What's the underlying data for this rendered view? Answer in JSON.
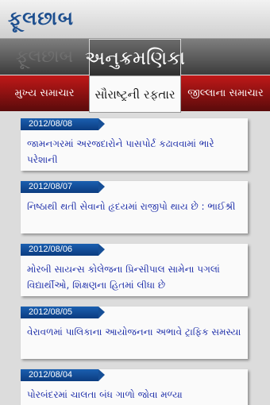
{
  "header": {
    "logo": "ફૂલછાબ"
  },
  "top_tabs": [
    {
      "label": "ફૂલછાબ"
    },
    {
      "label": "અનુક્રમણિકા"
    }
  ],
  "section_tabs": [
    {
      "label": "મુખ્ય સમાચાર"
    },
    {
      "label": "સૌરાષ્ટ્રની રફતાર"
    },
    {
      "label": "જીલ્લાના સમાચાર"
    }
  ],
  "colors": {
    "accent": "#1d4f8f",
    "tab_red": "#c01818",
    "headline": "#1a2ba8"
  },
  "news": [
    {
      "date": "2012/08/08",
      "title": "જામનગરમાં અરજદારોને પાસપોર્ટ કઢાવવામાં ભારે પરેશાની"
    },
    {
      "date": "2012/08/07",
      "title": "નિષ્ઠાથી થતી સેવાનો હૃદયમાં રાજીપો થાય છે : ભાઈશ્રી"
    },
    {
      "date": "2012/08/06",
      "title": "મોરબી સાયન્સ કોલેજના પ્રિન્સીપાલ સામેના પગલાં વિદ્યાર્થીઓ, શિક્ષણના હિતમાં લીધા છે"
    },
    {
      "date": "2012/08/05",
      "title": "વેરાવળમાં પાલિકાના આયોજનના અભાવે ટ્રાફિક સમસ્યા"
    },
    {
      "date": "2012/08/04",
      "title": "પોરબંદરમાં ચાલતા બંધ ગાળો જોવા મળ્યા"
    }
  ]
}
